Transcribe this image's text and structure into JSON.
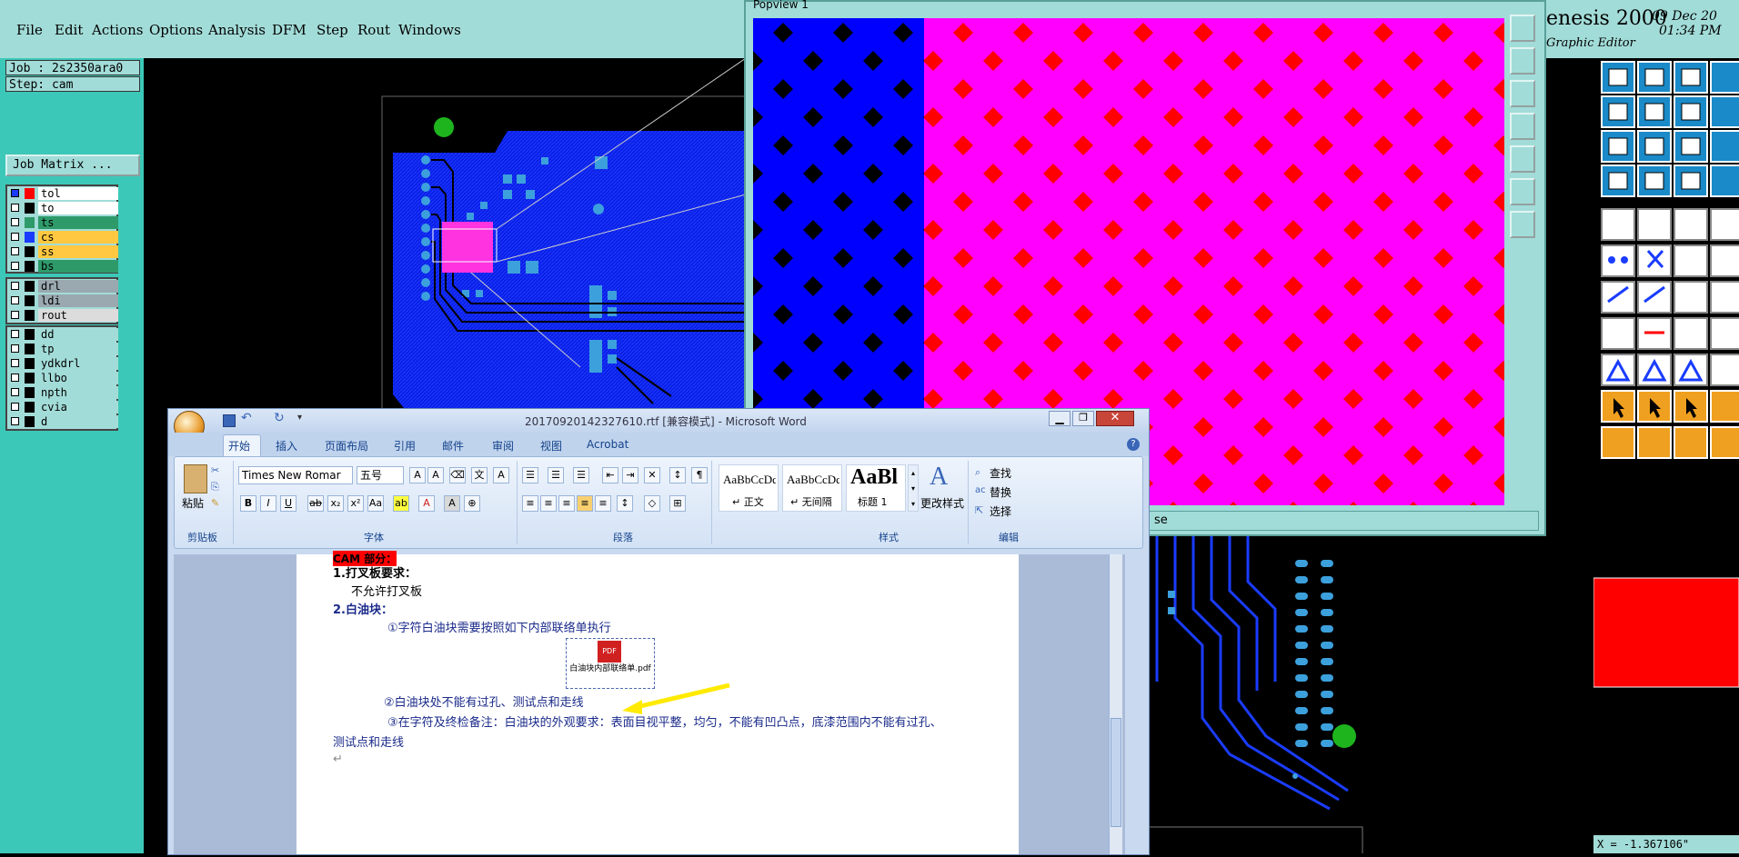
{
  "menubar": {
    "items": [
      "File",
      "Edit",
      "Actions",
      "Options",
      "Analysis",
      "DFM",
      "Step",
      "Rout",
      "Windows"
    ]
  },
  "job": {
    "label": "Job : 2s2350ara0",
    "step": "Step: cam",
    "matrix_button": "Job Matrix ..."
  },
  "layers": {
    "board": [
      {
        "name": "tol",
        "color": "#ffffff",
        "swatch": "#ff0000"
      },
      {
        "name": "to",
        "color": "#ffffff",
        "swatch": "#ffffff"
      },
      {
        "name": "ts",
        "color": "#2e9a6a",
        "swatch": "#2e9a6a"
      },
      {
        "name": "cs",
        "color": "#ffc840",
        "swatch": "#1a3cff"
      },
      {
        "name": "ss",
        "color": "#ffc840",
        "swatch": "#ffc840"
      },
      {
        "name": "bs",
        "color": "#2e9a6a",
        "swatch": "#2e9a6a"
      }
    ],
    "drill": [
      {
        "name": "drl",
        "color": "#9aa8b0"
      },
      {
        "name": "ldi",
        "color": "#9aa8b0"
      },
      {
        "name": "rout",
        "color": "#dcdcdc"
      }
    ],
    "misc": [
      "dd",
      "tp",
      "ydkdrl",
      "llbo",
      "npth",
      "cvia",
      "d"
    ]
  },
  "genesis": {
    "title": "enesis 2000",
    "subtitle": "Graphic Editor",
    "date": "09 Dec 20",
    "time": "01:34 PM",
    "popview_title": "Popview 1",
    "popview_status": "se",
    "coord_readout": "X = -1.367106\""
  },
  "word": {
    "title": "20170920142327610.rtf [兼容模式] - Microsoft Word",
    "tabs": [
      "开始",
      "插入",
      "页面布局",
      "引用",
      "邮件",
      "审阅",
      "视图",
      "Acrobat"
    ],
    "font_name": "Times New Romar",
    "font_size": "五号",
    "paste_label": "粘贴",
    "groups": [
      "剪贴板",
      "字体",
      "段落",
      "样式",
      "编辑"
    ],
    "styles": [
      {
        "preview": "AaBbCcDd",
        "name": "↵ 正文"
      },
      {
        "preview": "AaBbCcDd",
        "name": "↵ 无间隔"
      },
      {
        "preview": "AaBl",
        "name": "标题 1"
      }
    ],
    "change_styles": "更改样式",
    "edit": {
      "find": "查找",
      "replace": "替换",
      "select": "选择"
    },
    "doc": {
      "line_header": "CAM 部分：",
      "h1": "1.打叉板要求：",
      "l1": "不允许打叉板",
      "h2": "2.白油块：",
      "l2": "①字符白油块需要按照如下内部联络单执行",
      "attachment": "白油块内部联络单.pdf",
      "attachment_badge": "PDF",
      "l3": "②白油块处不能有过孔、测试点和走线",
      "l4": "③在字符及终检备注：白油块的外观要求：表面目视平整，均匀，不能有凹凸点，底漆范围内不能有过孔、",
      "l5": "测试点和走线"
    }
  }
}
